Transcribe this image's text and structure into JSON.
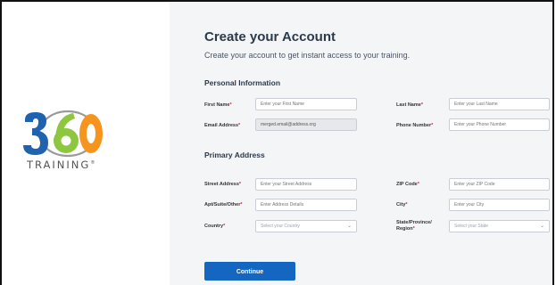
{
  "logo": {
    "brand": "360",
    "subtitle": "TRAINING",
    "mark": "®"
  },
  "header": {
    "title": "Create your Account",
    "subtitle": "Create your account to get instant access to your training."
  },
  "personal": {
    "section_title": "Personal Information",
    "first_name": {
      "label": "First Name",
      "placeholder": "Enter your First Name"
    },
    "last_name": {
      "label": "Last Name",
      "placeholder": "Enter your Last Name"
    },
    "email": {
      "label": "Email Address",
      "value": "merged.email@address.org"
    },
    "phone": {
      "label": "Phone Number",
      "placeholder": "Enter your Phone Number"
    }
  },
  "address": {
    "section_title": "Primary Address",
    "street": {
      "label": "Street Address",
      "placeholder": "Enter your Street Address"
    },
    "zip": {
      "label": "ZIP Code",
      "placeholder": "Enter your ZIP Code"
    },
    "apt": {
      "label": "Apt/Suite/Other",
      "placeholder": "Enter Address Details"
    },
    "city": {
      "label": "City",
      "placeholder": "Enter your City"
    },
    "country": {
      "label": "Country",
      "selected": "Select your Country"
    },
    "state": {
      "label_line1": "State/Province/",
      "label_line2": "Region",
      "selected": "Select your State"
    }
  },
  "required_mark": "*",
  "continue_label": "Continue",
  "colors": {
    "accent": "#1566c0",
    "logo_blue": "#1f63b0",
    "logo_green": "#8dc63f",
    "logo_orange": "#f7941d",
    "required": "#d0292f"
  }
}
